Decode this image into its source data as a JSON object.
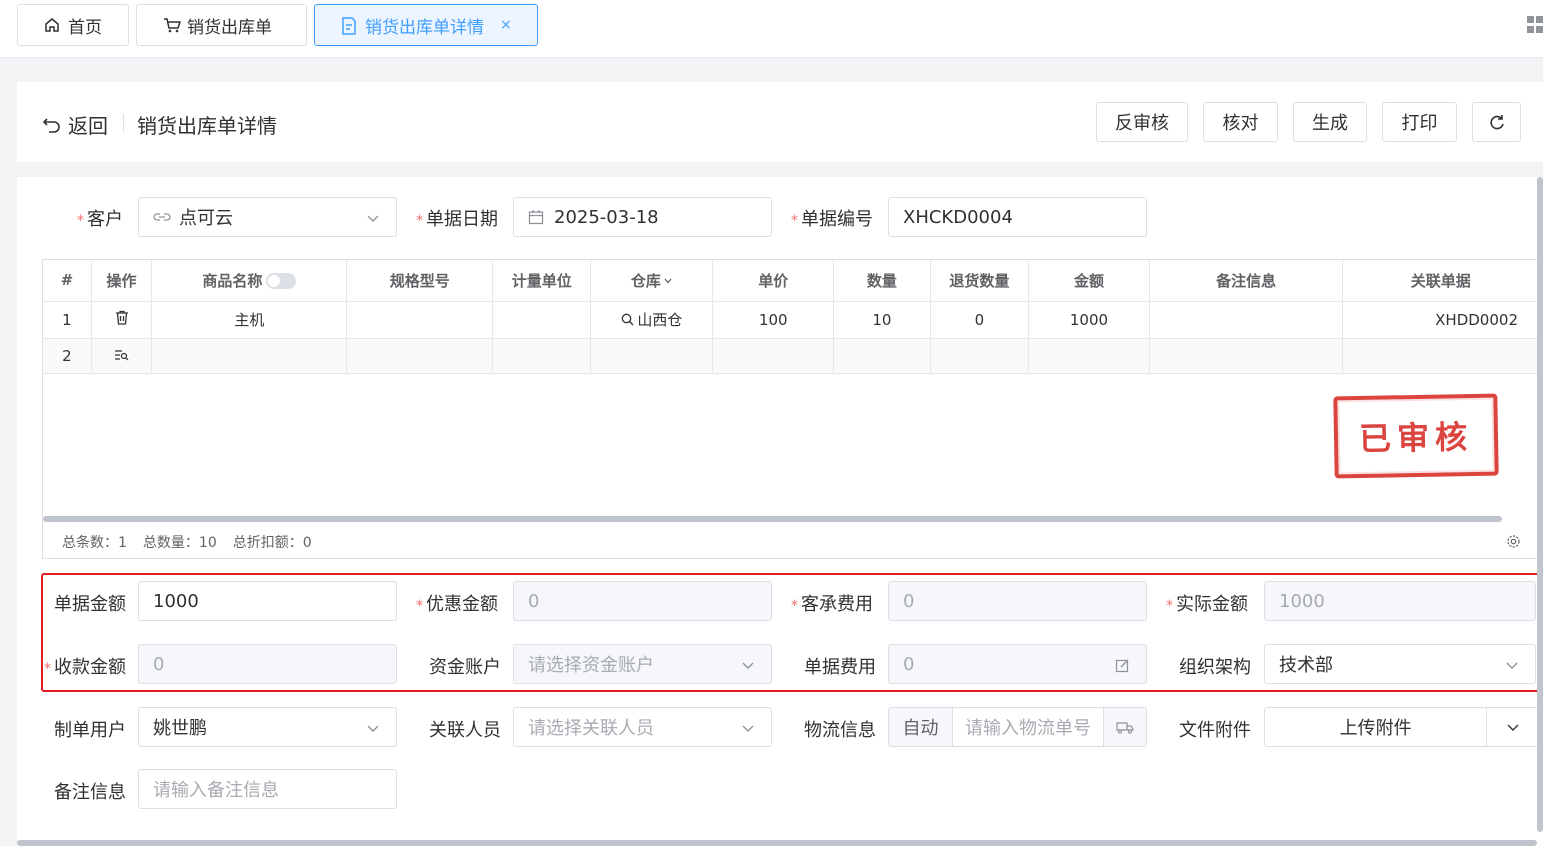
{
  "tabs": [
    {
      "label": "首页",
      "icon": "home-icon"
    },
    {
      "label": "销货出库单",
      "icon": "cart-icon"
    },
    {
      "label": "销货出库单详情",
      "icon": "document-icon",
      "active": true,
      "close": "×"
    }
  ],
  "header": {
    "back_label": "返回",
    "title": "销货出库单详情",
    "buttons": [
      "反审核",
      "核对",
      "生成",
      "打印"
    ]
  },
  "form": {
    "customer_label": "客户",
    "customer_value": "点可云",
    "date_label": "单据日期",
    "date_value": "2025-03-18",
    "number_label": "单据编号",
    "number_value": "XHCKD0004"
  },
  "table": {
    "headers": [
      "#",
      "操作",
      "商品名称",
      "规格型号",
      "计量单位",
      "仓库",
      "单价",
      "数量",
      "退货数量",
      "金额",
      "备注信息",
      "关联单据"
    ],
    "rows": [
      {
        "index": "1",
        "name": "主机",
        "spec": "",
        "unit": "",
        "warehouse": "山西仓",
        "price": "100",
        "qty": "10",
        "return_qty": "0",
        "amount": "1000",
        "remark": "",
        "related": "XHDD0002"
      },
      {
        "index": "2",
        "name": "",
        "spec": "",
        "unit": "",
        "warehouse": "",
        "price": "",
        "qty": "",
        "return_qty": "",
        "amount": "",
        "remark": "",
        "related": ""
      }
    ]
  },
  "summary": {
    "total_rows": "总条数：1",
    "total_qty": "总数量：10",
    "total_discount": "总折扣额：0"
  },
  "stamp": "已审核",
  "bottom": {
    "doc_amount_label": "单据金额",
    "doc_amount_value": "1000",
    "discount_label": "优惠金额",
    "discount_value": "0",
    "customer_fee_label": "客承费用",
    "customer_fee_value": "0",
    "actual_label": "实际金额",
    "actual_value": "1000",
    "received_label": "收款金额",
    "received_value": "0",
    "account_label": "资金账户",
    "account_placeholder": "请选择资金账户",
    "doc_fee_label": "单据费用",
    "doc_fee_value": "0",
    "org_label": "组织架构",
    "org_value": "技术部",
    "creator_label": "制单用户",
    "creator_value": "姚世鹏",
    "related_person_label": "关联人员",
    "related_person_placeholder": "请选择关联人员",
    "logistics_label": "物流信息",
    "logistics_prefix": "自动",
    "logistics_placeholder": "请输入物流单号",
    "attachment_label": "文件附件",
    "attachment_button": "上传附件",
    "remark_label": "备注信息",
    "remark_placeholder": "请输入备注信息"
  },
  "colors": {
    "accent": "#409eff",
    "stamp": "#d9352f",
    "highlight_box": "#e02020"
  }
}
